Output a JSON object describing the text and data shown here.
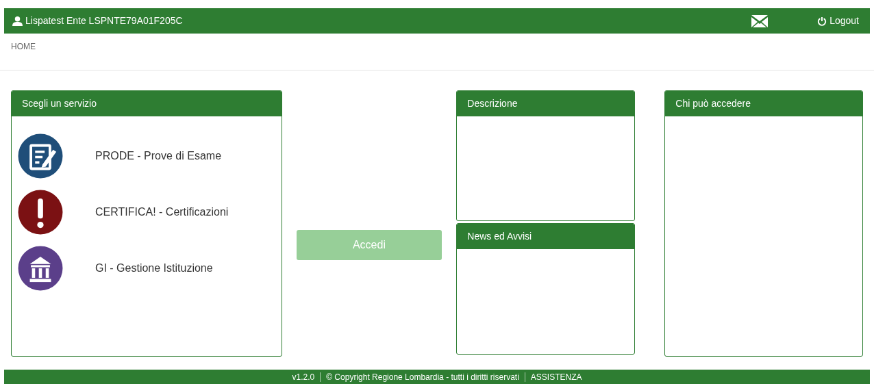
{
  "header": {
    "user": "Lispatest Ente LSPNTE79A01F205C",
    "logout": "Logout"
  },
  "breadcrumb": [
    "HOME"
  ],
  "services_panel": {
    "title": "Scegli un servizio",
    "items": [
      {
        "kind": "document",
        "color": "#1f4e79",
        "label": "PRODE - Prove di Esame",
        "selected": false
      },
      {
        "kind": "alert",
        "color": "#7b1113",
        "label": "CERTIFICA! - Certificazioni",
        "selected": false
      },
      {
        "kind": "building",
        "color": "#5b3f8a",
        "label": "GI - Gestione Istituzione",
        "selected": false
      }
    ]
  },
  "access_button": {
    "label": "Accedi",
    "disabled": true
  },
  "description_panel": {
    "title": "Descrizione"
  },
  "news_panel": {
    "title": "News ed Avvisi"
  },
  "access_panel": {
    "title": "Chi può accedere"
  },
  "footer": {
    "version": "v1.2.0",
    "copyright": "© Copyright Regione Lombardia - tutti i diritti riservati",
    "support": "ASSISTENZA"
  }
}
